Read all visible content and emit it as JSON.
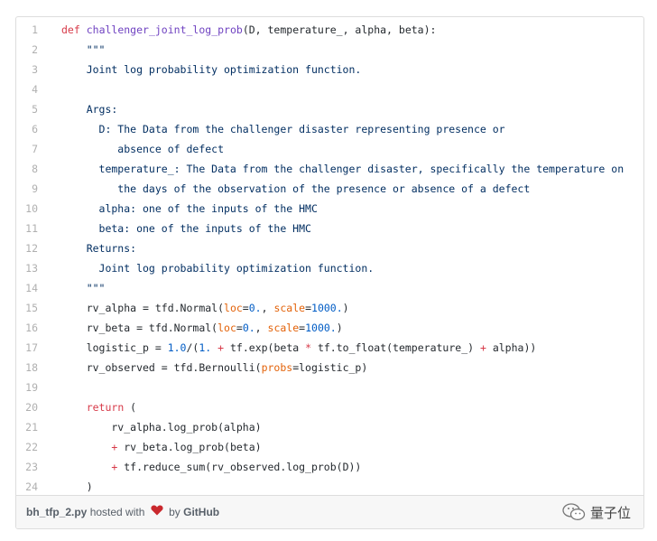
{
  "code": {
    "lines": [
      {
        "n": "1",
        "t": "def challenger_joint_log_prob(D, temperature_, alpha, beta):"
      },
      {
        "n": "2",
        "t": "    \"\"\""
      },
      {
        "n": "3",
        "t": "    Joint log probability optimization function."
      },
      {
        "n": "4",
        "t": ""
      },
      {
        "n": "5",
        "t": "    Args:"
      },
      {
        "n": "6",
        "t": "      D: The Data from the challenger disaster representing presence or"
      },
      {
        "n": "7",
        "t": "         absence of defect"
      },
      {
        "n": "8",
        "t": "      temperature_: The Data from the challenger disaster, specifically the temperature on"
      },
      {
        "n": "9",
        "t": "         the days of the observation of the presence or absence of a defect"
      },
      {
        "n": "10",
        "t": "      alpha: one of the inputs of the HMC"
      },
      {
        "n": "11",
        "t": "      beta: one of the inputs of the HMC"
      },
      {
        "n": "12",
        "t": "    Returns:"
      },
      {
        "n": "13",
        "t": "      Joint log probability optimization function."
      },
      {
        "n": "14",
        "t": "    \"\"\""
      },
      {
        "n": "15",
        "t": "    rv_alpha = tfd.Normal(loc=0., scale=1000.)"
      },
      {
        "n": "16",
        "t": "    rv_beta = tfd.Normal(loc=0., scale=1000.)"
      },
      {
        "n": "17",
        "t": "    logistic_p = 1.0/(1. + tf.exp(beta * tf.to_float(temperature_) + alpha))"
      },
      {
        "n": "18",
        "t": "    rv_observed = tfd.Bernoulli(probs=logistic_p)"
      },
      {
        "n": "19",
        "t": ""
      },
      {
        "n": "20",
        "t": "    return ("
      },
      {
        "n": "21",
        "t": "        rv_alpha.log_prob(alpha)"
      },
      {
        "n": "22",
        "t": "        + rv_beta.log_prob(beta)"
      },
      {
        "n": "23",
        "t": "        + tf.reduce_sum(rv_observed.log_prob(D))"
      },
      {
        "n": "24",
        "t": "    )"
      }
    ]
  },
  "footer": {
    "filename": "bh_tfp_2.py",
    "hosted_text": "hosted with",
    "by_text": "by",
    "github": "GitHub",
    "heart_color": "#c9282d"
  },
  "watermark": {
    "text": "量子位",
    "icon": "wechat-icon"
  }
}
